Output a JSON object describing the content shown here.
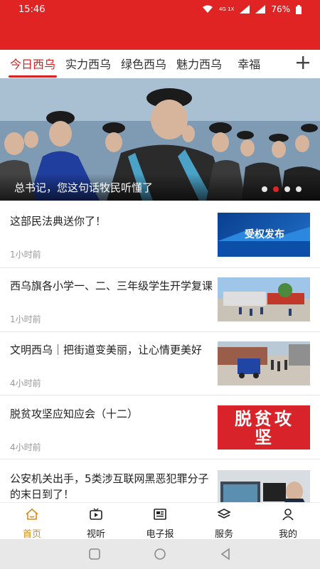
{
  "status": {
    "time": "15:46",
    "network": "4G 1X",
    "battery": "76%"
  },
  "tabs": [
    {
      "label": "今日西乌",
      "active": true
    },
    {
      "label": "实力西乌",
      "active": false
    },
    {
      "label": "绿色西乌",
      "active": false
    },
    {
      "label": "魅力西乌",
      "active": false
    },
    {
      "label": "幸福",
      "active": false
    }
  ],
  "banner": {
    "caption": "总书记，您这句话牧民听懂了",
    "slide_index": 2,
    "slide_count": 4
  },
  "news": [
    {
      "title": "这部民法典送你了！",
      "time": "1小时前",
      "thumb_text": "受权发布"
    },
    {
      "title": "西乌旗各小学一、二、三年级学生开学复课",
      "time": "1小时前"
    },
    {
      "title": "文明西乌｜把街道变美丽，让心情更美好",
      "time": "4小时前"
    },
    {
      "title": "脱贫攻坚应知应会（十二）",
      "time": "4小时前",
      "thumb_text": "脱贫攻坚"
    },
    {
      "title": "公安机关出手，5类涉互联网黑恶犯罪分子的末日到了！",
      "time": ""
    }
  ],
  "bottom_nav": [
    {
      "label": "首页",
      "icon": "home-icon",
      "active": true
    },
    {
      "label": "视听",
      "icon": "tv-icon",
      "active": false
    },
    {
      "label": "电子报",
      "icon": "newspaper-icon",
      "active": false
    },
    {
      "label": "服务",
      "icon": "layers-icon",
      "active": false
    },
    {
      "label": "我的",
      "icon": "user-icon",
      "active": false
    }
  ],
  "colors": {
    "brand_red": "#e02424",
    "active_tab": "#d32323",
    "nav_active": "#d38b1f"
  }
}
